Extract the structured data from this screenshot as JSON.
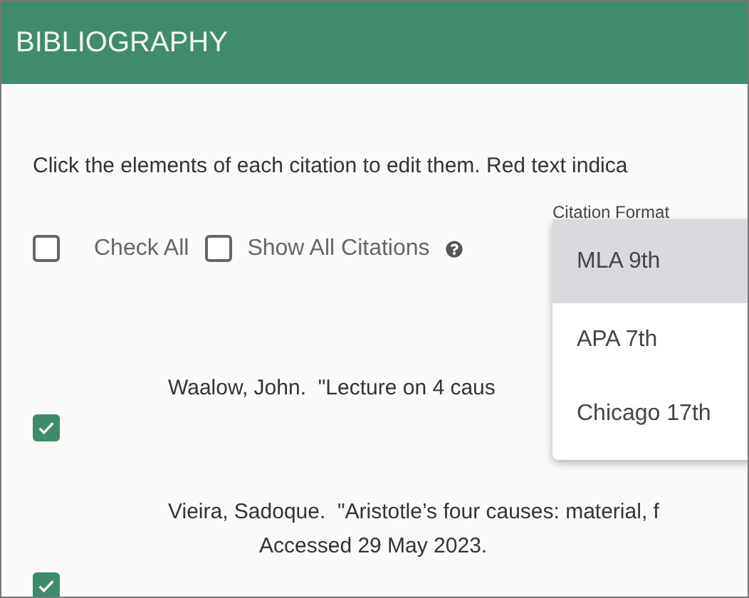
{
  "header": {
    "title": "BIBLIOGRAPHY"
  },
  "instructions": "Click the elements of each citation to edit them. Red text indica",
  "controls": [
    {
      "label": "Check All",
      "checked": false,
      "help": false
    },
    {
      "label": "Show All Citations",
      "checked": false,
      "help": true
    }
  ],
  "citation_format": {
    "label": "Citation Format",
    "options": [
      {
        "label": "MLA 9th",
        "selected": true
      },
      {
        "label": "APA 7th",
        "selected": false
      },
      {
        "label": "Chicago 17th",
        "selected": false
      }
    ]
  },
  "citations": [
    {
      "lines": [
        "Waalow, John.  \"Lecture on 4 caus"
      ],
      "checked": true
    },
    {
      "lines": [
        "Vieira, Sadoque.  \"Aristotle’s four causes: material, f",
        "Accessed 29 May 2023."
      ],
      "checked": true
    }
  ]
}
